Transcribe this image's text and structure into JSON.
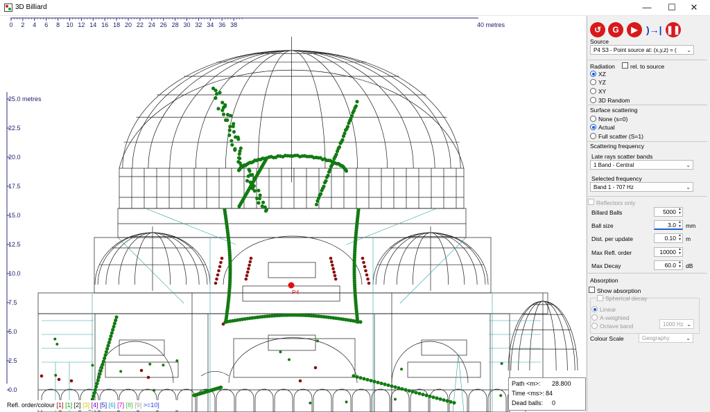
{
  "window": {
    "title": "3D Billiard",
    "minimize": "—",
    "maximize": "☐",
    "close": "✕"
  },
  "viewport": {
    "x_ticks": [
      "0",
      "2",
      "4",
      "6",
      "8",
      "10",
      "12",
      "14",
      "16",
      "18",
      "20",
      "22",
      "24",
      "26",
      "28",
      "30",
      "32",
      "34",
      "36",
      "38"
    ],
    "x_unit_label": "40 metres",
    "y_ticks": [
      "25.0 metres",
      "22.5",
      "20.0",
      "17.5",
      "15.0",
      "12.5",
      "10.0",
      "7.5",
      "5.0",
      "2.5",
      "0.0"
    ],
    "source_label": "P4",
    "legend_prefix": "Refl. order/colour",
    "legend_items": [
      {
        "text": "[1]",
        "color": "#8b0000"
      },
      {
        "text": "[1]",
        "color": "#00a000"
      },
      {
        "text": "[2]",
        "color": "#1f1f1f"
      },
      {
        "text": "[3]",
        "color": "#c8c800"
      },
      {
        "text": "[4]",
        "color": "#8000c0"
      },
      {
        "text": "[5]",
        "color": "#2020c0"
      },
      {
        "text": "[6]",
        "color": "#20a0c0"
      },
      {
        "text": "[7]",
        "color": "#c000c0"
      },
      {
        "text": "[8]",
        "color": "#40c040"
      },
      {
        "text": "[9]",
        "color": "#a0a0a0"
      },
      {
        "text": ">=10]",
        "color": "#2040e0"
      }
    ],
    "colors": {
      "structure": "#1a1a1a",
      "rays": "#137a13",
      "late_rays": "#8b1010",
      "teal": "#2e9c9c",
      "source": "#e01010",
      "axis": "#2a2a7a"
    }
  },
  "info": {
    "path_label": "Path <m>:",
    "path_value": "28.800",
    "time_label": "Time <ms>:",
    "time_value": "84",
    "dead_label": "Dead balls:",
    "dead_value": "0"
  },
  "toolbar": {
    "icons": [
      "reset-icon",
      "refresh-icon",
      "play-icon",
      "step-icon",
      "pause-icon"
    ]
  },
  "panel": {
    "source_heading": "Source",
    "source_value": "P4 S3  -  Point source at: (x,y,z) = (",
    "radiation_heading": "Radiation",
    "rel_to_source": "rel. to source",
    "radiation_options": [
      "XZ",
      "YZ",
      "XY",
      "3D Random"
    ],
    "radiation_selected": "XZ",
    "scattering_heading": "Surface scattering",
    "scattering_options": [
      "None (s=0)",
      "Actual",
      "Full scatter (S=1)"
    ],
    "scattering_selected": "Actual",
    "scatter_freq_heading": "Scattering frequency",
    "late_rays_label": "Late rays scatter bands",
    "late_rays_value": "1 Band - Central",
    "selected_freq_label": "Selected frequency",
    "selected_freq_value": "Band 1 - 707 Hz",
    "reflectors_only": "Reflectors only",
    "params": [
      {
        "label": "Billard Balls",
        "value": "5000",
        "unit": ""
      },
      {
        "label": "Ball size",
        "value": "3.0",
        "unit": "mm"
      },
      {
        "label": "Dist. per update",
        "value": "0.10",
        "unit": "m"
      },
      {
        "label": "Max Refl. order",
        "value": "10000",
        "unit": ""
      },
      {
        "label": "Max Decay",
        "value": "60.0",
        "unit": "dB"
      }
    ],
    "absorption_heading": "Absorption",
    "show_absorption": "Show absorption",
    "spherical_decay": "Spherical decay",
    "decay_options": [
      "Linear",
      "A-weighted",
      "Octave band"
    ],
    "octave_value": "1000 Hz",
    "colour_scale_label": "Colour Scale",
    "colour_scale_value": "Geography"
  }
}
